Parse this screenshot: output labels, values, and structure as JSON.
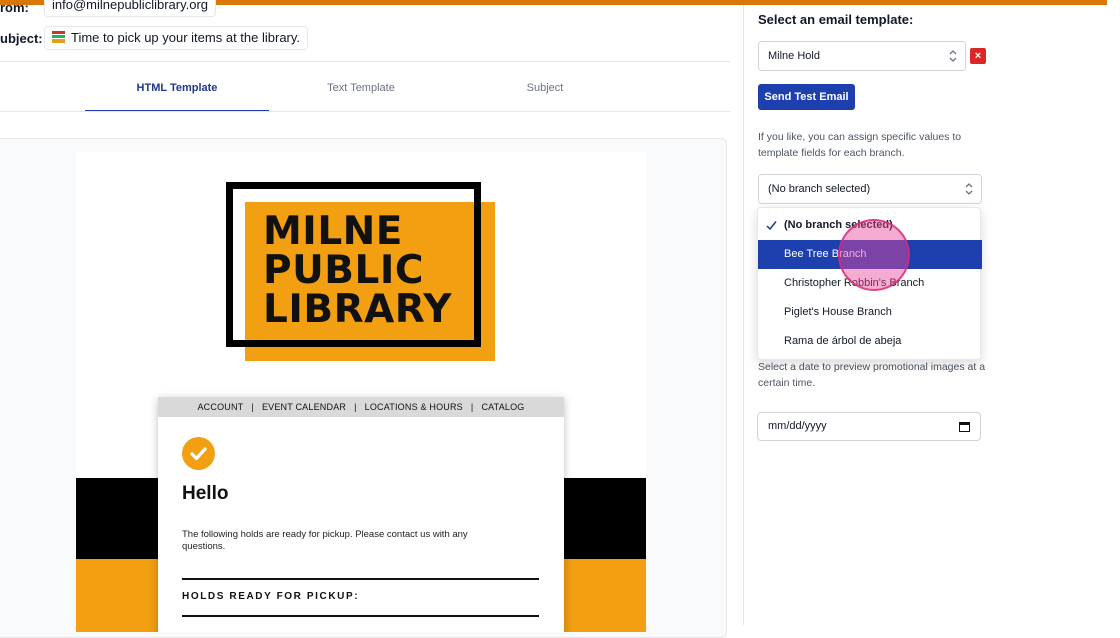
{
  "header": {
    "from_label": "rom:",
    "from_value": "info@milnepubliclibrary.org",
    "subject_label": "ubject:",
    "subject_value": "Time to pick up your items at the library."
  },
  "tabs": [
    {
      "label": "HTML Template",
      "active": true
    },
    {
      "label": "Text Template",
      "active": false
    },
    {
      "label": "Subject",
      "active": false
    }
  ],
  "email_preview": {
    "logo_lines": [
      "MILNE",
      "PUBLIC",
      "LIBRARY"
    ],
    "nav": [
      "ACCOUNT",
      "EVENT CALENDAR",
      "LOCATIONS & HOURS",
      "CATALOG"
    ],
    "nav_separator": "|",
    "heading": "Hello",
    "body": "The following holds are ready for pickup. Please contact us with any questions.",
    "section_title": "HOLDS READY FOR PICKUP:"
  },
  "sidebar": {
    "template_title": "Select an email template:",
    "template_selected": "Milne Hold",
    "remove_label": "×",
    "send_test_label": "Send Test Email",
    "branch_help": "If you like, you can assign specific values to template fields for each branch.",
    "branch_selected": "(No branch selected)",
    "branch_options": [
      "(No branch selected)",
      "Bee Tree Branch",
      "Christopher Robbin's Branch",
      "Piglet's House Branch",
      "Rama de árbol de abeja"
    ],
    "date_help": "Select a date to preview promotional images at a certain time.",
    "date_placeholder": "mm/dd/yyyy"
  },
  "colors": {
    "accent": "#1e40af",
    "brand_orange": "#f29f12",
    "top_bar": "#d97706",
    "danger": "#dc2626"
  }
}
